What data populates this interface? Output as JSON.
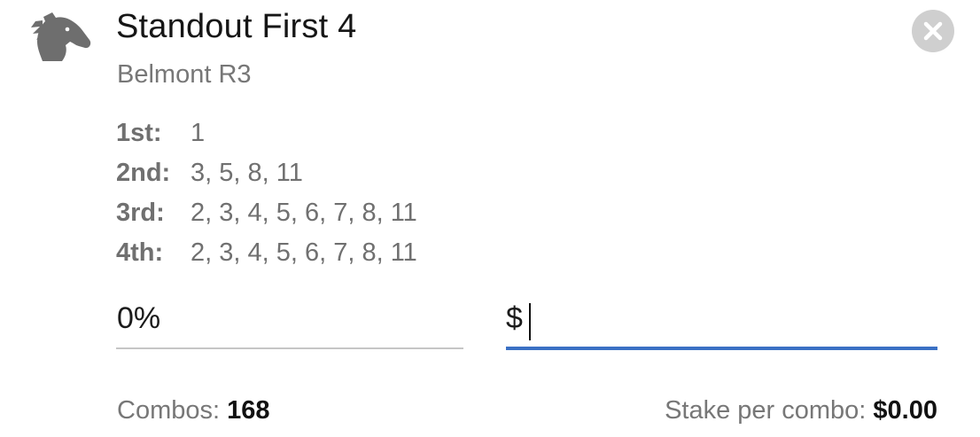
{
  "bet": {
    "title": "Standout First 4",
    "race": "Belmont R3",
    "icon": "horse-head-icon"
  },
  "selections": [
    {
      "label": "1st:",
      "value": "1"
    },
    {
      "label": "2nd:",
      "value": "3, 5, 8, 11"
    },
    {
      "label": "3rd:",
      "value": "2, 3, 4, 5, 6, 7, 8, 11"
    },
    {
      "label": "4th:",
      "value": "2, 3, 4, 5, 6, 7, 8, 11"
    }
  ],
  "inputs": {
    "percent_value": "0%",
    "amount_prefix": "$",
    "amount_value": ""
  },
  "summary": {
    "combos_label": "Combos:",
    "combos_value": "168",
    "stake_label": "Stake per combo:",
    "stake_value": "$0.00"
  },
  "colors": {
    "accent": "#3a70c4",
    "icon": "#6e6e6e",
    "close_bg": "#cfcfcf",
    "muted_text": "#777777"
  }
}
